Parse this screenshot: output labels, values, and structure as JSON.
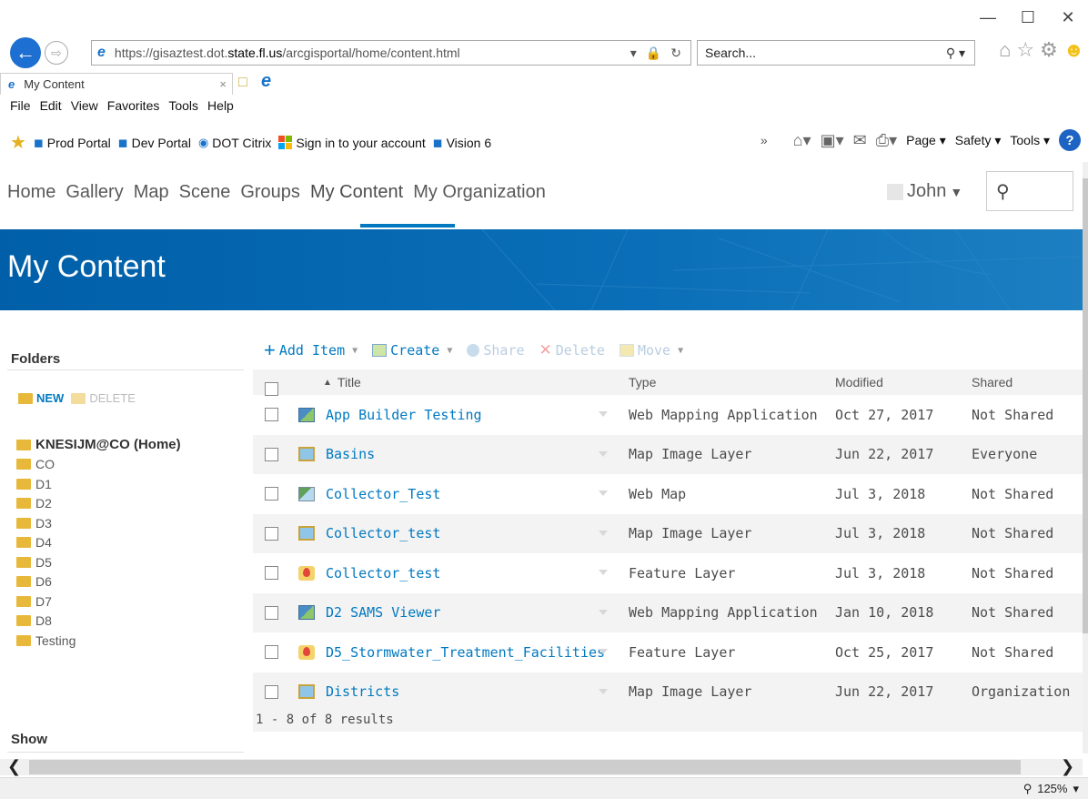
{
  "browser": {
    "url_prefix": "https://gisaztest.dot.",
    "url_domain": "state.fl.us",
    "url_path": "/arcgisportal/home/content.html",
    "search_placeholder": "Search...",
    "tab_title": "My Content",
    "menu": [
      "File",
      "Edit",
      "View",
      "Favorites",
      "Tools",
      "Help"
    ],
    "favorites": [
      {
        "label": "Prod Portal",
        "icon": "ie-page-icon"
      },
      {
        "label": "Dev Portal",
        "icon": "ie-page-icon"
      },
      {
        "label": "DOT Citrix",
        "icon": "citrix-icon"
      },
      {
        "label": "Sign in to your account",
        "icon": "microsoft-logo-icon"
      },
      {
        "label": "Vision 6",
        "icon": "ie-page-icon"
      }
    ],
    "command_bar": {
      "page": "Page",
      "safety": "Safety",
      "tools": "Tools"
    },
    "zoom": "125%"
  },
  "portal": {
    "nav": [
      "Home",
      "Gallery",
      "Map",
      "Scene",
      "Groups",
      "My Content",
      "My Organization"
    ],
    "active_nav": "My Content",
    "user": "John",
    "page_title": "My Content",
    "accent": "#0079c1"
  },
  "sidebar": {
    "folders_heading": "Folders",
    "new_label": "NEW",
    "delete_label": "DELETE",
    "folders": [
      "KNESIJM@CO (Home)",
      "CO",
      "D1",
      "D2",
      "D3",
      "D4",
      "D5",
      "D6",
      "D7",
      "D8",
      "Testing"
    ],
    "show_heading": "Show"
  },
  "toolbar": {
    "add_item": "Add Item",
    "create": "Create",
    "share": "Share",
    "delete": "Delete",
    "move": "Move"
  },
  "table": {
    "headers": {
      "title": "Title",
      "type": "Type",
      "modified": "Modified",
      "shared": "Shared"
    },
    "rows": [
      {
        "title": "App Builder Testing",
        "type": "Web Mapping Application",
        "modified": "Oct 27, 2017",
        "shared": "Not Shared",
        "icon": "web-mapping-app-icon"
      },
      {
        "title": "Basins",
        "type": "Map Image Layer",
        "modified": "Jun 22, 2017",
        "shared": "Everyone",
        "icon": "map-image-layer-icon"
      },
      {
        "title": "Collector_Test",
        "type": "Web Map",
        "modified": "Jul 3, 2018",
        "shared": "Not Shared",
        "icon": "web-map-icon"
      },
      {
        "title": "Collector_test",
        "type": "Map Image Layer",
        "modified": "Jul 3, 2018",
        "shared": "Not Shared",
        "icon": "map-image-layer-icon"
      },
      {
        "title": "Collector_test",
        "type": "Feature Layer",
        "modified": "Jul 3, 2018",
        "shared": "Not Shared",
        "icon": "feature-layer-icon"
      },
      {
        "title": "D2 SAMS Viewer",
        "type": "Web Mapping Application",
        "modified": "Jan 10, 2018",
        "shared": "Not Shared",
        "icon": "web-mapping-app-icon"
      },
      {
        "title": "D5_Stormwater_Treatment_Facilities",
        "type": "Feature Layer",
        "modified": "Oct 25, 2017",
        "shared": "Not Shared",
        "icon": "feature-layer-icon"
      },
      {
        "title": "Districts",
        "type": "Map Image Layer",
        "modified": "Jun 22, 2017",
        "shared": "Organization",
        "icon": "map-image-layer-icon"
      }
    ],
    "results": "1 - 8 of 8 results"
  }
}
